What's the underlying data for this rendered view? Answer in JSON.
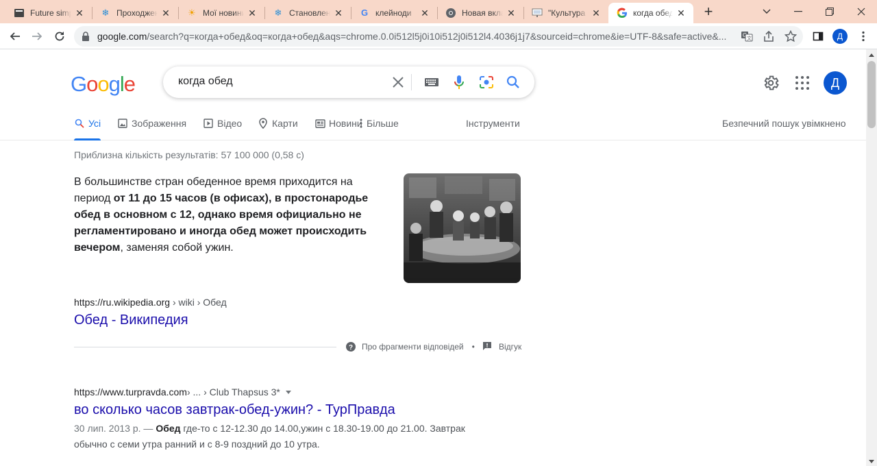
{
  "browser": {
    "tabs": [
      {
        "title": "Future simp",
        "icon": "bookmark-icon",
        "active": false
      },
      {
        "title": "Проходжен",
        "icon": "snowflake-icon",
        "active": false
      },
      {
        "title": "Мої новини",
        "icon": "sun-icon",
        "active": false
      },
      {
        "title": "Становлен",
        "icon": "snowflake-icon",
        "active": false
      },
      {
        "title": "клейноди",
        "icon": "google-icon",
        "active": false
      },
      {
        "title": "Новая вкла",
        "icon": "chrome-icon",
        "active": false
      },
      {
        "title": "\"Культура I",
        "icon": "presentation-icon",
        "active": false
      },
      {
        "title": "когда обед",
        "icon": "google-icon",
        "active": true
      }
    ],
    "url_host": "google.com",
    "url_rest": "/search?q=когда+обед&oq=когда+обед&aqs=chrome.0.0i512l5j0i10i512j0i512l4.4036j1j7&sourceid=chrome&ie=UTF-8&safe=active&...",
    "profile_initial": "Д"
  },
  "google": {
    "logo": [
      "G",
      "o",
      "o",
      "g",
      "l",
      "e"
    ],
    "logo_colors": [
      "#4285f4",
      "#ea4335",
      "#fbbc05",
      "#4285f4",
      "#34a853",
      "#ea4335"
    ],
    "query": "когда обед",
    "avatar_initial": "Д"
  },
  "search_tabs": {
    "all": "Усі",
    "images": "Зображення",
    "video": "Відео",
    "maps": "Карти",
    "news": "Новини",
    "more": "Більше",
    "tools": "Інструменти",
    "safe_search": "Безпечний пошук увімкнено"
  },
  "results": {
    "stats": "Приблизна кількість результатів: 57 100 000 (0,58 с)",
    "featured": {
      "text_before": "В большинстве стран обеденное время приходится на период ",
      "text_bold": "от 11 до 15 часов (в офисах), в простонародье обед в основном с 12, однако время официально не регламентировано и иногда обед может происходить вечером",
      "text_after": ", заменяя собой ужин."
    },
    "first": {
      "cite_host": "https://ru.wikipedia.org",
      "cite_path": " › wiki › Обед",
      "title": "Обед - Википедия"
    },
    "about_snippets": "Про фрагменти відповідей",
    "separator": "•",
    "feedback": "Відгук",
    "second": {
      "cite_host": "https://www.turpravda.com",
      "cite_path": " › ... › Club Thapsus 3*",
      "title": "во сколько часов завтрак-обед-ужин? - ТурПравда",
      "date": "30 лип. 2013 р. — ",
      "desc_bold": "Обед",
      "desc_rest": " где-то с 12-12.30 до 14.00,ужин с 18.30-19.00 до 21.00. Завтрак обычно с семи утра ранний и с 8-9 поздний до 10 утра."
    }
  }
}
